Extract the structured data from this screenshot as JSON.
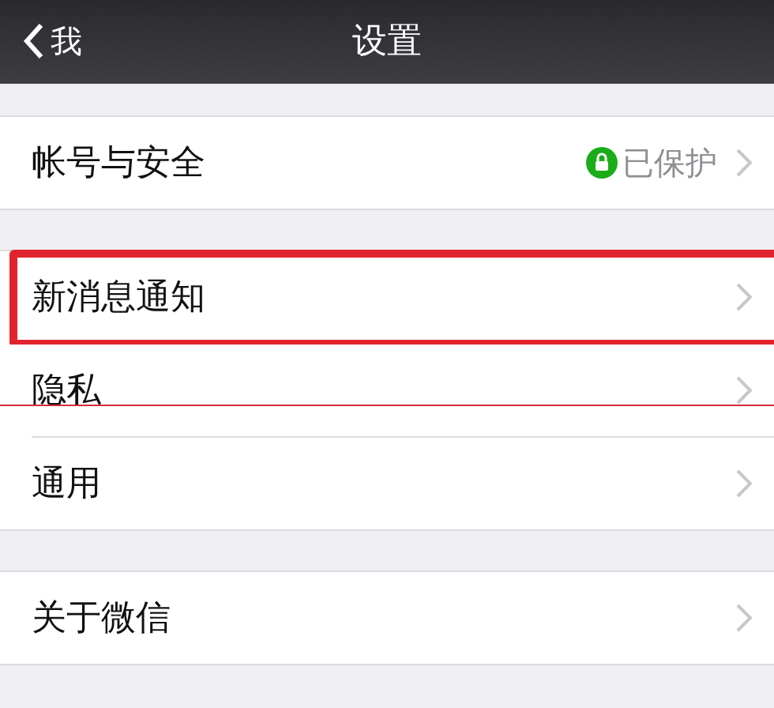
{
  "nav_bar": {
    "back_label": "我",
    "title": "设置"
  },
  "groups": [
    {
      "items": [
        {
          "label": "帐号与安全",
          "status": "已保护",
          "highlighted": false,
          "crossed": false
        }
      ]
    },
    {
      "items": [
        {
          "label": "新消息通知",
          "highlighted": true,
          "crossed": false
        },
        {
          "label": "隐私",
          "highlighted": false,
          "crossed": true
        },
        {
          "label": "通用",
          "highlighted": false,
          "crossed": false
        }
      ]
    },
    {
      "items": [
        {
          "label": "关于微信",
          "highlighted": false,
          "crossed": false
        }
      ]
    }
  ]
}
